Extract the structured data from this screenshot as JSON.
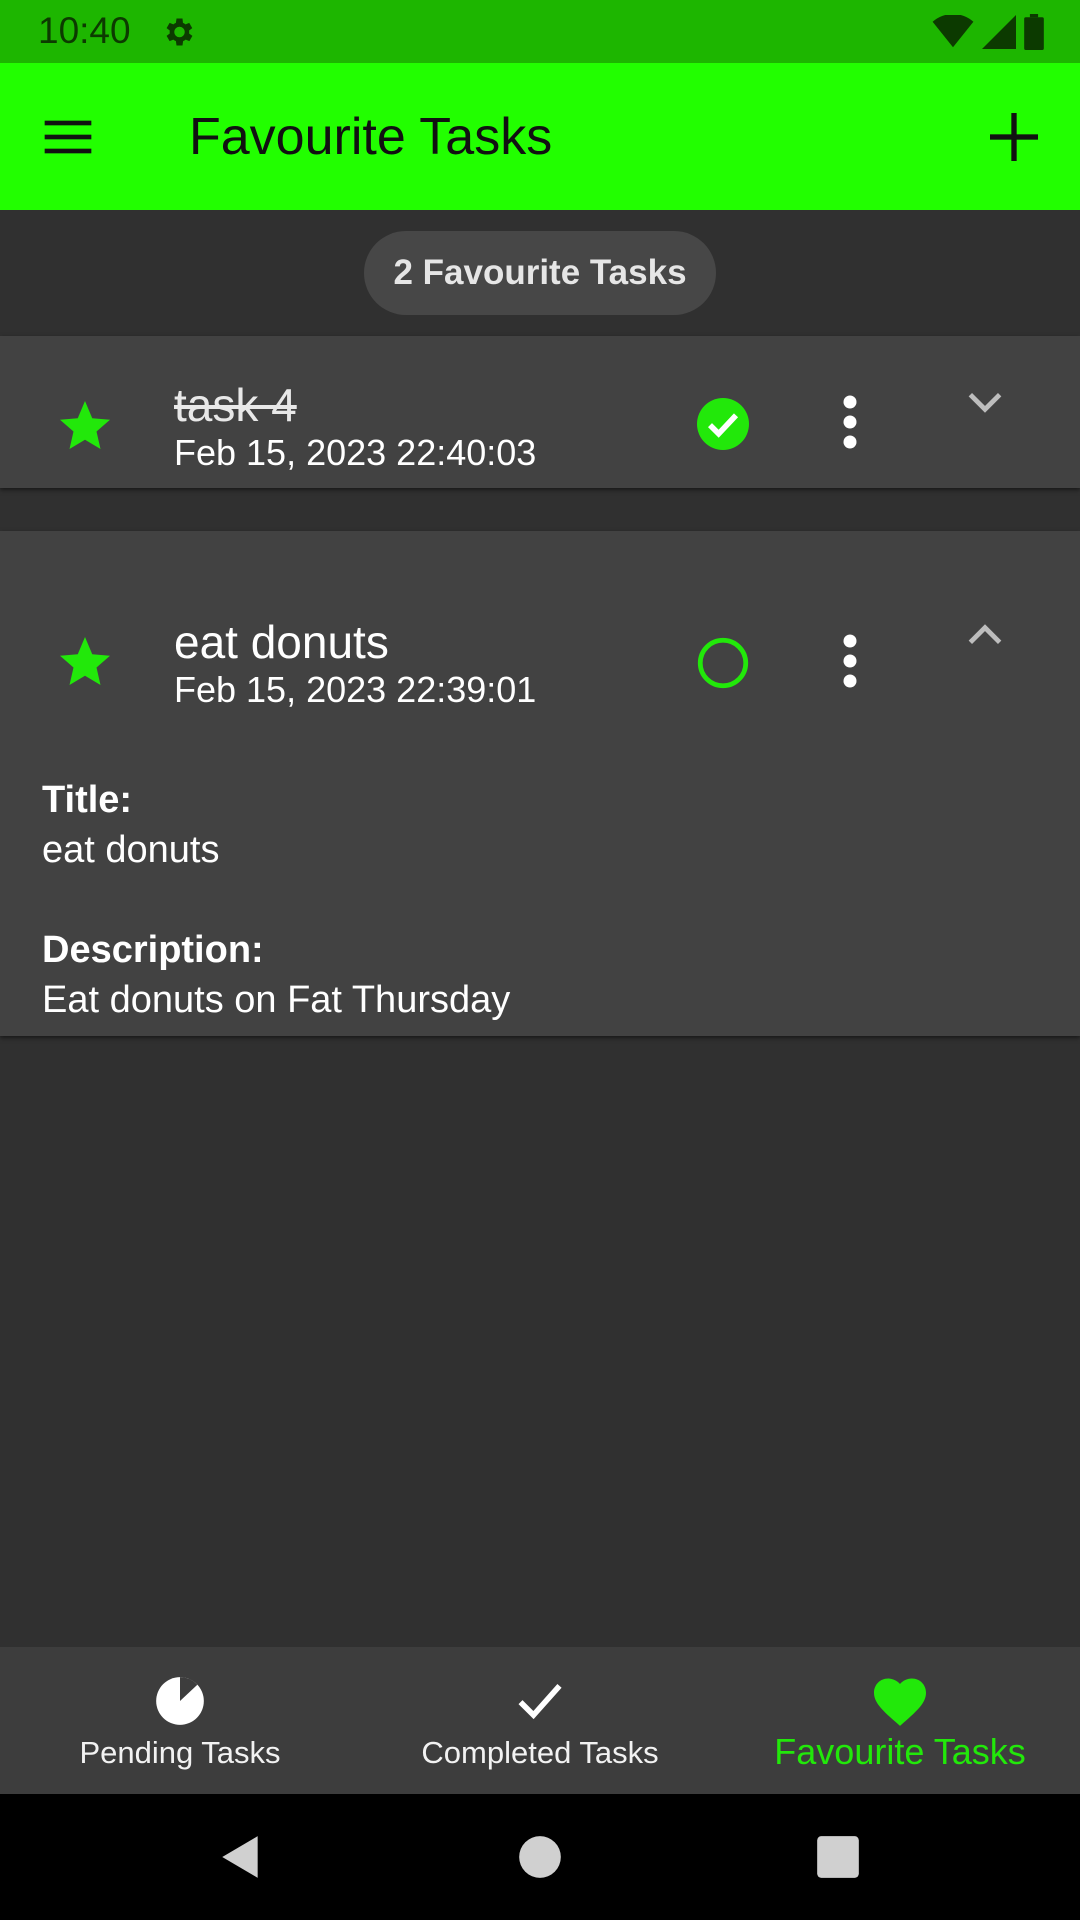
{
  "status_bar": {
    "time": "10:40",
    "icons": [
      "gear-icon",
      "wifi-icon",
      "signal-icon",
      "battery-icon"
    ]
  },
  "app_bar": {
    "title": "Favourite Tasks",
    "menu_icon": "hamburger-menu-icon",
    "add_icon": "plus-icon"
  },
  "summary": {
    "count_label": "2 Favourite Tasks"
  },
  "tasks": [
    {
      "title": "task 4",
      "date": "Feb 15, 2023 22:40:03",
      "completed": true,
      "favourite": true,
      "expanded": false
    },
    {
      "title": "eat donuts",
      "date": "Feb 15, 2023 22:39:01",
      "completed": false,
      "favourite": true,
      "expanded": true,
      "details": {
        "title_label": "Title:",
        "title_value": "eat donuts",
        "description_label": "Description:",
        "description_value": "Eat donuts on Fat Thursday"
      }
    }
  ],
  "bottom_nav": {
    "items": [
      {
        "label": "Pending Tasks",
        "icon": "pie-chart-icon",
        "active": false
      },
      {
        "label": "Completed Tasks",
        "icon": "checkmark-icon",
        "active": false
      },
      {
        "label": "Favourite Tasks",
        "icon": "heart-icon",
        "active": true
      }
    ]
  },
  "colors": {
    "accent": "#22ff00",
    "status_bar": "#1db600",
    "background": "#303030",
    "card": "#424242"
  }
}
